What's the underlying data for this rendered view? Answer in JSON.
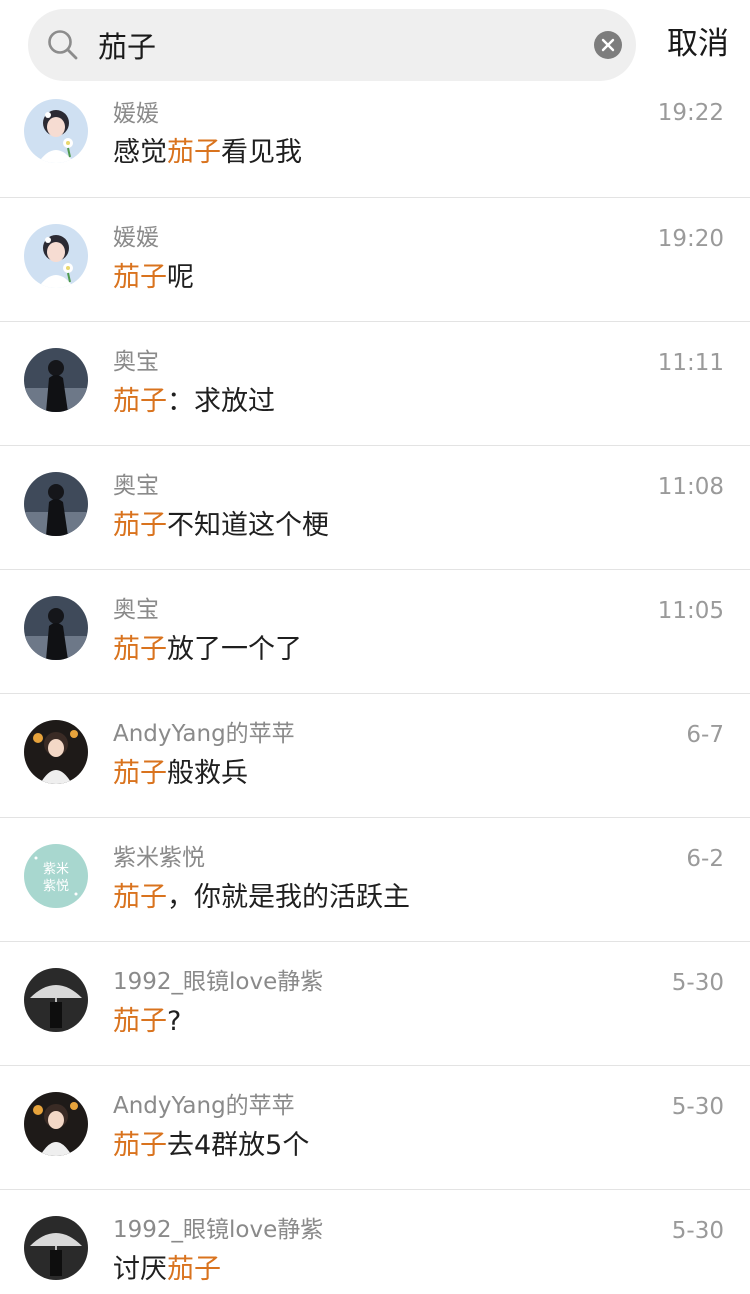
{
  "search": {
    "query": "茄子",
    "cancel_label": "取消"
  },
  "colors": {
    "highlight": "#d9731e",
    "name_gray": "#8a8a8a",
    "time_gray": "#9a9a9a",
    "search_bg": "#efefef"
  },
  "results": [
    {
      "name": "媛媛",
      "time": "19:22",
      "message": [
        {
          "text": "感觉",
          "hl": false
        },
        {
          "text": "茄子",
          "hl": true
        },
        {
          "text": "看见我",
          "hl": false
        }
      ],
      "avatar": "girl-flower"
    },
    {
      "name": "媛媛",
      "time": "19:20",
      "message": [
        {
          "text": "茄子",
          "hl": true
        },
        {
          "text": "呢",
          "hl": false
        }
      ],
      "avatar": "girl-flower"
    },
    {
      "name": "奥宝",
      "time": "11:11",
      "message": [
        {
          "text": "茄子",
          "hl": true
        },
        {
          "text": "：求放过",
          "hl": false
        }
      ],
      "avatar": "dark-figure"
    },
    {
      "name": "奥宝",
      "time": "11:08",
      "message": [
        {
          "text": "茄子",
          "hl": true
        },
        {
          "text": "不知道这个梗",
          "hl": false
        }
      ],
      "avatar": "dark-figure"
    },
    {
      "name": "奥宝",
      "time": "11:05",
      "message": [
        {
          "text": "茄子",
          "hl": true
        },
        {
          "text": "放了一个了",
          "hl": false
        }
      ],
      "avatar": "dark-figure"
    },
    {
      "name": "AndyYang的苹苹",
      "time": "6-7",
      "message": [
        {
          "text": "茄子",
          "hl": true
        },
        {
          "text": "般救兵",
          "hl": false
        }
      ],
      "avatar": "girl-lantern"
    },
    {
      "name": "紫米紫悦",
      "time": "6-2",
      "message": [
        {
          "text": "茄子",
          "hl": true
        },
        {
          "text": "，你就是我的活跃主",
          "hl": false
        }
      ],
      "avatar": "text-logo",
      "avatar_text": [
        "紫米",
        "紫悦"
      ]
    },
    {
      "name": "1992_眼镜love静紫",
      "time": "5-30",
      "message": [
        {
          "text": "茄子",
          "hl": true
        },
        {
          "text": "?",
          "hl": false
        }
      ],
      "avatar": "umbrella"
    },
    {
      "name": "AndyYang的苹苹",
      "time": "5-30",
      "message": [
        {
          "text": "茄子",
          "hl": true
        },
        {
          "text": "去4群放5个",
          "hl": false
        }
      ],
      "avatar": "girl-lantern"
    },
    {
      "name": "1992_眼镜love静紫",
      "time": "5-30",
      "message": [
        {
          "text": "讨厌",
          "hl": false
        },
        {
          "text": "茄子",
          "hl": true
        }
      ],
      "avatar": "umbrella"
    }
  ]
}
